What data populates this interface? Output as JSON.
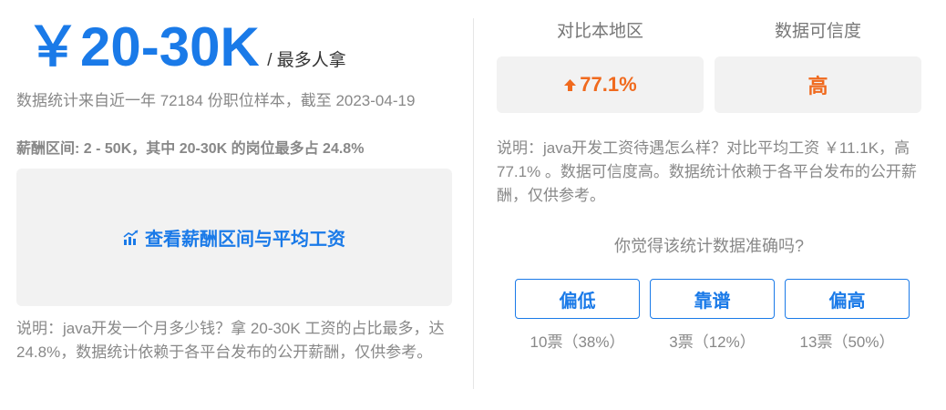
{
  "left": {
    "salary": "￥20-30K",
    "salary_suffix": "/ 最多人拿",
    "stat_line": "数据统计来自近一年 72184 份职位样本，截至 2023-04-19",
    "range_line": "薪酬区间: 2 - 50K，其中 20-30K 的岗位最多占 24.8%",
    "cta_label": "查看薪酬区间与平均工资",
    "cta_icon": "bar-chart-icon",
    "note": "说明：java开发一个月多少钱？拿 20-30K 工资的占比最多，达 24.8%，数据统计依赖于各平台发布的公开薪酬，仅供参考。"
  },
  "right": {
    "metrics": [
      {
        "label": "对比本地区",
        "value": "77.1%",
        "icon": "arrow-up-icon"
      },
      {
        "label": "数据可信度",
        "value": "高"
      }
    ],
    "note": "说明：java开发工资待遇怎么样？对比平均工资 ￥11.1K，高 77.1% 。数据可信度高。数据统计依赖于各平台发布的公开薪酬，仅供参考。",
    "question": "你觉得该统计数据准确吗?",
    "votes": [
      {
        "label": "偏低",
        "count": "10票（38%）"
      },
      {
        "label": "靠谱",
        "count": "3票（12%）"
      },
      {
        "label": "偏高",
        "count": "13票（50%）"
      }
    ]
  },
  "colors": {
    "accent": "#1a7ae8",
    "highlight": "#f06a1e",
    "muted_text": "#888888",
    "panel_bg": "#f2f2f2"
  }
}
